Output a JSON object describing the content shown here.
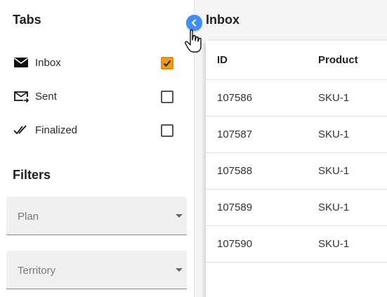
{
  "sidebar": {
    "tabs_title": "Tabs",
    "tabs": [
      {
        "label": "Inbox",
        "icon": "mail-icon",
        "checked": true
      },
      {
        "label": "Sent",
        "icon": "mail-sent-icon",
        "checked": false
      },
      {
        "label": "Finalized",
        "icon": "double-check-icon",
        "checked": false
      }
    ],
    "filters_title": "Filters",
    "filters": [
      {
        "placeholder": "Plan"
      },
      {
        "placeholder": "Territory"
      }
    ]
  },
  "main": {
    "title": "Inbox",
    "table": {
      "columns": [
        "ID",
        "Product"
      ],
      "rows": [
        [
          "107586",
          "SKU-1"
        ],
        [
          "107587",
          "SKU-1"
        ],
        [
          "107588",
          "SKU-1"
        ],
        [
          "107589",
          "SKU-1"
        ],
        [
          "107590",
          "SKU-1"
        ]
      ]
    }
  },
  "colors": {
    "accent_checkbox": "#f39c12",
    "collapse_button": "#3f8ef7"
  }
}
